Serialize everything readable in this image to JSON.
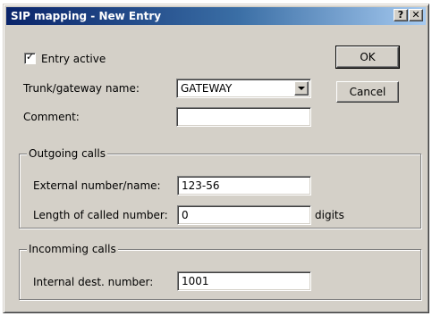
{
  "window": {
    "title": "SIP mapping - New Entry",
    "help_label": "?",
    "close_label": "✕"
  },
  "entry_active": {
    "label": "Entry active",
    "checked": true
  },
  "trunk": {
    "label": "Trunk/gateway name:",
    "selected": "GATEWAY"
  },
  "comment": {
    "label": "Comment:",
    "value": ""
  },
  "buttons": {
    "ok": "OK",
    "cancel": "Cancel"
  },
  "outgoing": {
    "title": "Outgoing calls",
    "external_label": "External number/name:",
    "external_value": "123-56",
    "length_label": "Length of called number:",
    "length_value": "0",
    "length_unit": "digits"
  },
  "incoming": {
    "title": "Incomming calls",
    "internal_label": "Internal dest. number:",
    "internal_value": "1001"
  }
}
